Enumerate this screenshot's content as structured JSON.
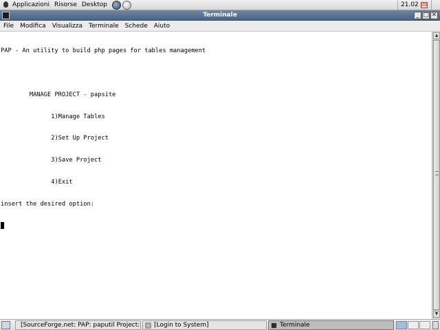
{
  "top_panel": {
    "menus": [
      "Applicazioni",
      "Risorse",
      "Desktop"
    ],
    "clock": "21.02",
    "tray_label": "ITA"
  },
  "window": {
    "title": "Terminale",
    "buttons": {
      "minimize": "_",
      "maximize": "□",
      "close": "✕"
    }
  },
  "menubar": [
    "File",
    "Modifica",
    "Visualizza",
    "Terminale",
    "Schede",
    "Aiuto"
  ],
  "terminal": {
    "lines": [
      "PAP - An utility to build php pages for tables management",
      "",
      "        MANAGE PROJECT - papsite",
      "              1)Manage Tables",
      "              2)Set Up Project",
      "              3)Save Project",
      "              4)Exit",
      "insert the desired option:"
    ]
  },
  "scrollbar": {
    "up": "▲",
    "down": "▼"
  },
  "taskbar": {
    "tasks": [
      {
        "label": "[SourceForge.net: PAP: paputil Project:...",
        "icon": "browser-icon",
        "active": false
      },
      {
        "label": "[Login to System]",
        "icon": "browser-icon",
        "active": false
      },
      {
        "label": "Terminale",
        "icon": "terminal-icon",
        "active": true
      }
    ]
  }
}
